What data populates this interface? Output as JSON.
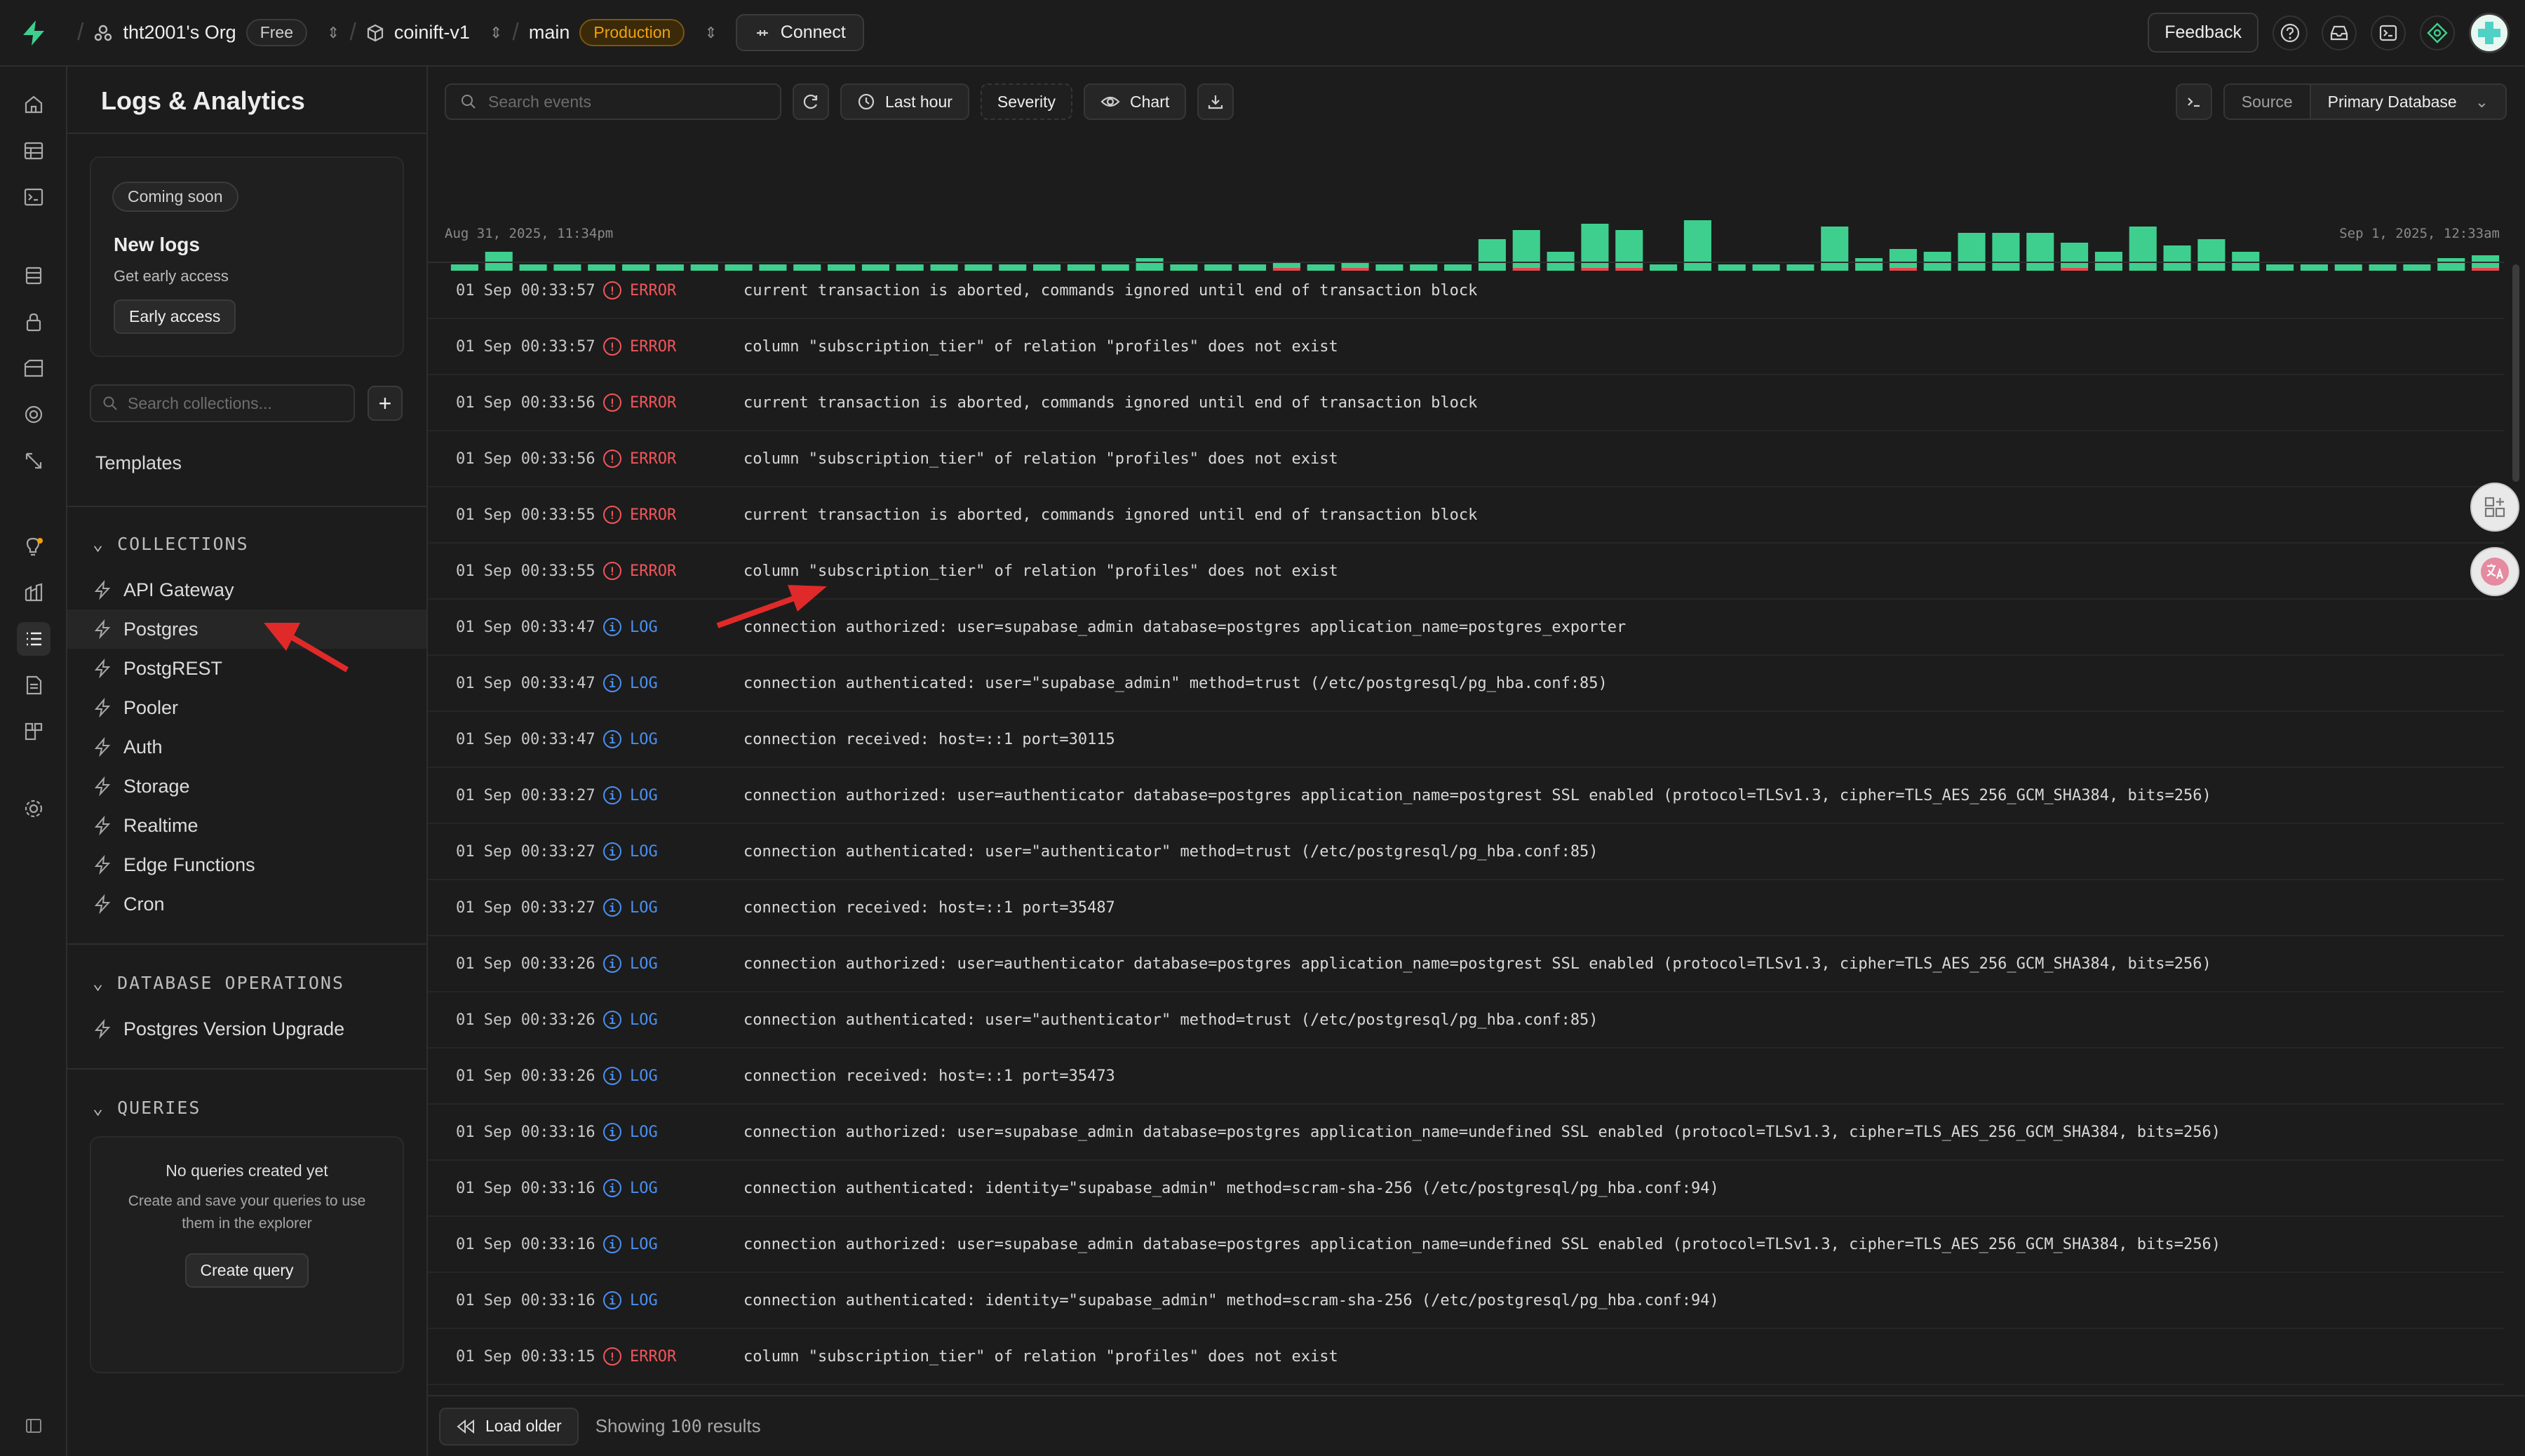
{
  "topbar": {
    "org_name": "tht2001's Org",
    "org_plan": "Free",
    "project_name": "coinift-v1",
    "branch_name": "main",
    "branch_env": "Production",
    "connect_label": "Connect",
    "feedback_label": "Feedback"
  },
  "sidebar": {
    "title": "Logs & Analytics",
    "promo": {
      "badge": "Coming soon",
      "title": "New logs",
      "subtitle": "Get early access",
      "button": "Early access"
    },
    "search_placeholder": "Search collections...",
    "templates_label": "Templates",
    "collections_header": "COLLECTIONS",
    "collections": [
      {
        "label": "API Gateway"
      },
      {
        "label": "Postgres",
        "active": true
      },
      {
        "label": "PostgREST"
      },
      {
        "label": "Pooler"
      },
      {
        "label": "Auth"
      },
      {
        "label": "Storage"
      },
      {
        "label": "Realtime"
      },
      {
        "label": "Edge Functions"
      },
      {
        "label": "Cron"
      }
    ],
    "db_ops_header": "DATABASE OPERATIONS",
    "db_ops": [
      {
        "label": "Postgres Version Upgrade"
      }
    ],
    "queries_header": "QUERIES",
    "queries_empty_title": "No queries created yet",
    "queries_empty_sub": "Create and save your queries to use them in the explorer",
    "create_query_label": "Create query"
  },
  "toolbar": {
    "search_placeholder": "Search events",
    "time_range": "Last hour",
    "severity_label": "Severity",
    "chart_label": "Chart",
    "source_label": "Source",
    "source_value": "Primary Database"
  },
  "chart_data": {
    "type": "bar",
    "x_start_label": "Aug 31, 2025, 11:34pm",
    "x_end_label": "Sep 1, 2025, 12:33am",
    "series_colors": {
      "log": "#3ecf8e",
      "error": "#e5484d"
    },
    "log_values": [
      1,
      3,
      1,
      1,
      1,
      1,
      1,
      1,
      1,
      1,
      1,
      1,
      1,
      1,
      1,
      1,
      1,
      1,
      1,
      1,
      2,
      1,
      1,
      1,
      1,
      1,
      1,
      1,
      1,
      1,
      5,
      6,
      3,
      7,
      6,
      1,
      8,
      1,
      1,
      1,
      7,
      2,
      3,
      3,
      6,
      6,
      6,
      4,
      3,
      7,
      4,
      5,
      3,
      1,
      1,
      1,
      1,
      1,
      2,
      2
    ],
    "error_values": [
      0,
      0,
      0,
      0,
      0,
      0,
      0,
      0,
      0,
      0,
      0,
      0,
      0,
      0,
      0,
      0,
      0,
      0,
      0,
      0,
      0,
      0,
      0,
      0,
      1,
      0,
      1,
      0,
      0,
      0,
      0,
      1,
      0,
      1,
      1,
      0,
      0,
      0,
      0,
      0,
      0,
      0,
      1,
      0,
      0,
      0,
      0,
      1,
      0,
      0,
      0,
      0,
      0,
      0,
      0,
      0,
      0,
      0,
      0,
      1
    ]
  },
  "logs": [
    {
      "ts": "01 Sep 00:33:57",
      "level": "ERROR",
      "msg": "current transaction is aborted, commands ignored until end of transaction block"
    },
    {
      "ts": "01 Sep 00:33:57",
      "level": "ERROR",
      "msg": "column \"subscription_tier\" of relation \"profiles\" does not exist"
    },
    {
      "ts": "01 Sep 00:33:56",
      "level": "ERROR",
      "msg": "current transaction is aborted, commands ignored until end of transaction block"
    },
    {
      "ts": "01 Sep 00:33:56",
      "level": "ERROR",
      "msg": "column \"subscription_tier\" of relation \"profiles\" does not exist"
    },
    {
      "ts": "01 Sep 00:33:55",
      "level": "ERROR",
      "msg": "current transaction is aborted, commands ignored until end of transaction block"
    },
    {
      "ts": "01 Sep 00:33:55",
      "level": "ERROR",
      "msg": "column \"subscription_tier\" of relation \"profiles\" does not exist"
    },
    {
      "ts": "01 Sep 00:33:47",
      "level": "LOG",
      "msg": "connection authorized: user=supabase_admin database=postgres application_name=postgres_exporter"
    },
    {
      "ts": "01 Sep 00:33:47",
      "level": "LOG",
      "msg": "connection authenticated: user=\"supabase_admin\" method=trust (/etc/postgresql/pg_hba.conf:85)"
    },
    {
      "ts": "01 Sep 00:33:47",
      "level": "LOG",
      "msg": "connection received: host=::1 port=30115"
    },
    {
      "ts": "01 Sep 00:33:27",
      "level": "LOG",
      "msg": "connection authorized: user=authenticator database=postgres application_name=postgrest SSL enabled (protocol=TLSv1.3, cipher=TLS_AES_256_GCM_SHA384, bits=256)"
    },
    {
      "ts": "01 Sep 00:33:27",
      "level": "LOG",
      "msg": "connection authenticated: user=\"authenticator\" method=trust (/etc/postgresql/pg_hba.conf:85)"
    },
    {
      "ts": "01 Sep 00:33:27",
      "level": "LOG",
      "msg": "connection received: host=::1 port=35487"
    },
    {
      "ts": "01 Sep 00:33:26",
      "level": "LOG",
      "msg": "connection authorized: user=authenticator database=postgres application_name=postgrest SSL enabled (protocol=TLSv1.3, cipher=TLS_AES_256_GCM_SHA384, bits=256)"
    },
    {
      "ts": "01 Sep 00:33:26",
      "level": "LOG",
      "msg": "connection authenticated: user=\"authenticator\" method=trust (/etc/postgresql/pg_hba.conf:85)"
    },
    {
      "ts": "01 Sep 00:33:26",
      "level": "LOG",
      "msg": "connection received: host=::1 port=35473"
    },
    {
      "ts": "01 Sep 00:33:16",
      "level": "LOG",
      "msg": "connection authorized: user=supabase_admin database=postgres application_name=undefined SSL enabled (protocol=TLSv1.3, cipher=TLS_AES_256_GCM_SHA384, bits=256)"
    },
    {
      "ts": "01 Sep 00:33:16",
      "level": "LOG",
      "msg": "connection authenticated: identity=\"supabase_admin\" method=scram-sha-256 (/etc/postgresql/pg_hba.conf:94)"
    },
    {
      "ts": "01 Sep 00:33:16",
      "level": "LOG",
      "msg": "connection authorized: user=supabase_admin database=postgres application_name=undefined SSL enabled (protocol=TLSv1.3, cipher=TLS_AES_256_GCM_SHA384, bits=256)"
    },
    {
      "ts": "01 Sep 00:33:16",
      "level": "LOG",
      "msg": "connection authenticated: identity=\"supabase_admin\" method=scram-sha-256 (/etc/postgresql/pg_hba.conf:94)"
    },
    {
      "ts": "01 Sep 00:33:15",
      "level": "ERROR",
      "msg": "column \"subscription_tier\" of relation \"profiles\" does not exist"
    }
  ],
  "footer": {
    "load_older": "Load older",
    "showing_prefix": "Showing",
    "showing_count": "100",
    "showing_suffix": "results"
  }
}
